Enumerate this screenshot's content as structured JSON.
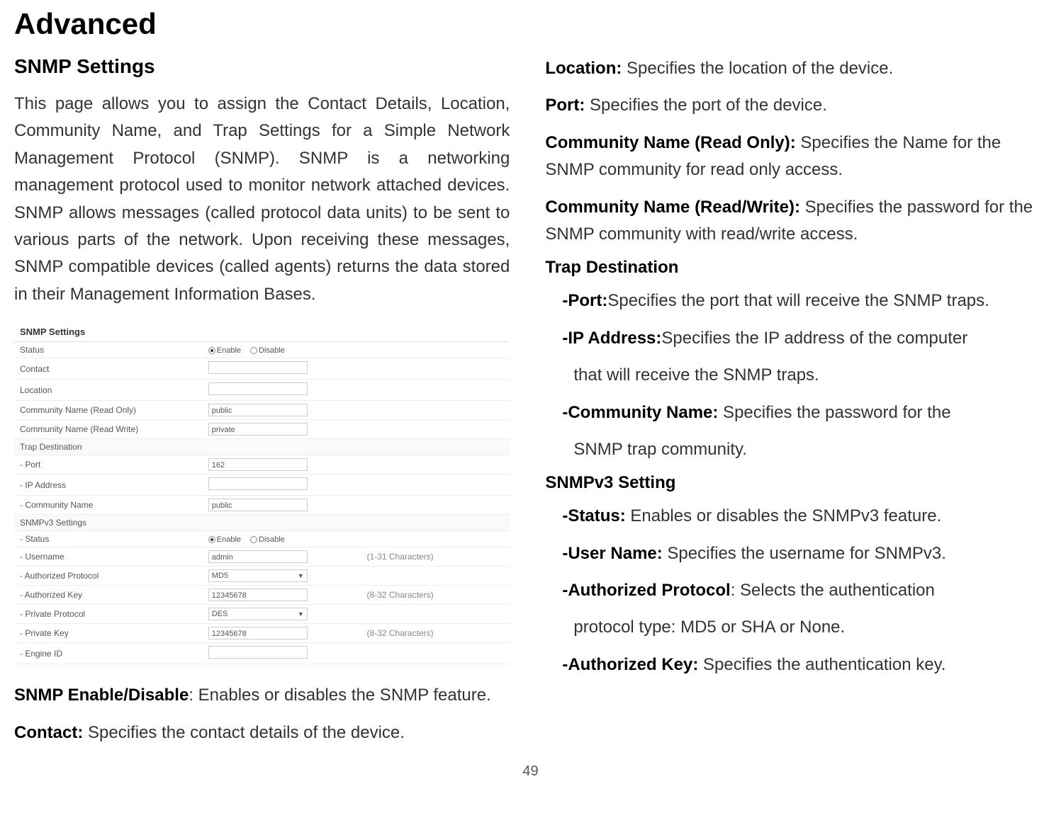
{
  "page_title": "Advanced",
  "page_number": "49",
  "left": {
    "heading": "SNMP Settings",
    "body": "This page allows you to assign the Contact Details, Location, Community Name, and Trap Settings for a Simple Network Management Protocol (SNMP). SNMP is a networking management protocol used to monitor network attached devices. SNMP allows messages (called protocol data units) to be sent to various parts of the network. Upon receiving these messages, SNMP compatible devices (called agents) returns the data stored in their Management Information Bases.",
    "table_title": "SNMP Settings",
    "rows": {
      "status_label": "Status",
      "status_enable": "Enable",
      "status_disable": "Disable",
      "contact_label": "Contact",
      "contact_value": "",
      "location_label": "Location",
      "location_value": "",
      "comm_ro_label": "Community Name (Read Only)",
      "comm_ro_value": "public",
      "comm_rw_label": "Community Name (Read Write)",
      "comm_rw_value": "private",
      "trap_dest_label": "Trap Destination",
      "trap_port_label": "- Port",
      "trap_port_value": "162",
      "trap_ip_label": "- IP Address",
      "trap_ip_value": "",
      "trap_comm_label": "- Community Name",
      "trap_comm_value": "public",
      "v3_settings_label": "SNMPv3 Settings",
      "v3_status_label": "- Status",
      "v3_status_enable": "Enable",
      "v3_status_disable": "Disable",
      "v3_user_label": "- Username",
      "v3_user_value": "admin",
      "v3_user_hint": "(1-31 Characters)",
      "v3_authproto_label": "- Authorized Protocol",
      "v3_authproto_value": "MD5",
      "v3_authkey_label": "- Authorized Key",
      "v3_authkey_value": "12345678",
      "v3_authkey_hint": "(8-32 Characters)",
      "v3_privproto_label": "- Private Protocol",
      "v3_privproto_value": "DES",
      "v3_privkey_label": "- Private Key",
      "v3_privkey_value": "12345678",
      "v3_privkey_hint": "(8-32 Characters)",
      "v3_engine_label": "- Engine ID",
      "v3_engine_value": ""
    },
    "snmp_enable_bold": "SNMP Enable/Disable",
    "snmp_enable_text": ": Enables or disables the SNMP feature.",
    "contact_bold": "Contact:",
    "contact_text": " Specifies the contact details of the device."
  },
  "right": {
    "location_bold": "Location:",
    "location_text": " Specifies the location of the device.",
    "port_bold": "Port:",
    "port_text": " Specifies the port of the device.",
    "comm_ro_bold": "Community Name (Read Only):",
    "comm_ro_text": " Specifies the Name for the SNMP community for read only access.",
    "comm_rw_bold": "Community Name (Read/Write):",
    "comm_rw_text": " Specifies the password for the SNMP community with read/write access.",
    "trap_heading": "Trap Destination",
    "trap_port_bold": "-Port:",
    "trap_port_text": "Specifies the port that will receive the SNMP traps.",
    "trap_ip_bold": "-IP Address:",
    "trap_ip_text": "Specifies the IP address of the computer",
    "trap_ip_cont": "that will receive the SNMP traps.",
    "trap_comm_bold": "-Community Name:",
    "trap_comm_text": " Specifies the password for the",
    "trap_comm_cont": "SNMP trap community.",
    "v3_heading": "SNMPv3 Setting",
    "v3_status_bold": "-Status:",
    "v3_status_text": " Enables or disables the SNMPv3 feature.",
    "v3_user_bold": "-User Name:",
    "v3_user_text": " Specifies the username for SNMPv3.",
    "v3_authproto_bold": "-Authorized Protocol",
    "v3_authproto_text": ": Selects the authentication",
    "v3_authproto_cont": "protocol type: MD5 or SHA or None.",
    "v3_authkey_bold": "-Authorized Key:",
    "v3_authkey_text": " Specifies the authentication key."
  }
}
